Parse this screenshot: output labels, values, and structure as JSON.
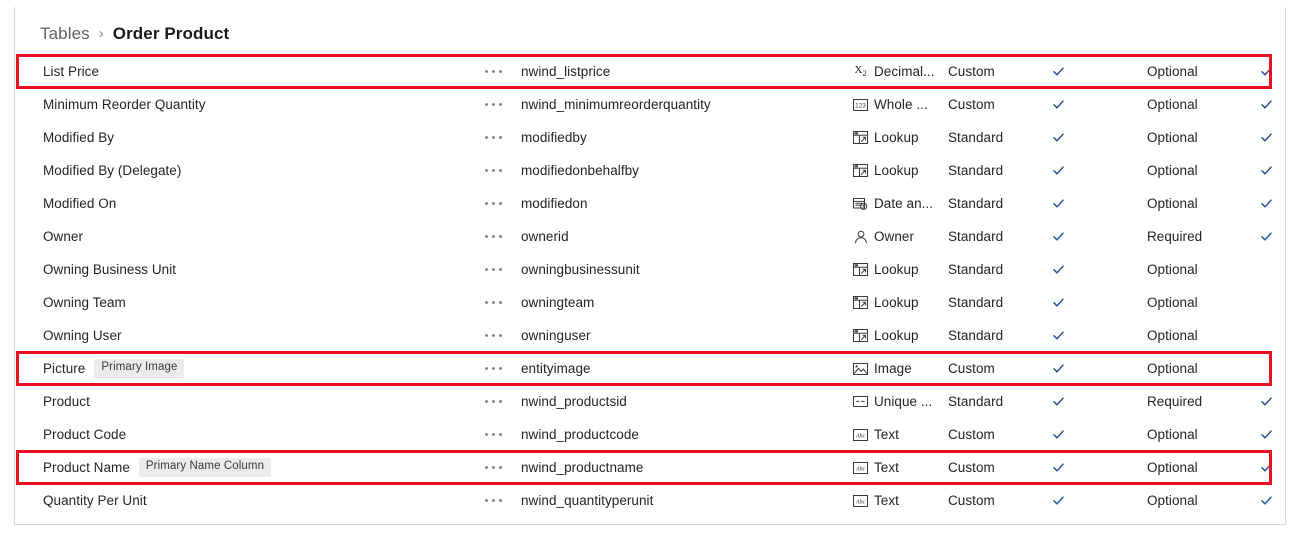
{
  "breadcrumb": {
    "parent": "Tables",
    "separator": "›",
    "current": "Order Product"
  },
  "colors": {
    "highlight": "#e81123",
    "checkmark": "#2b579a",
    "badge_bg": "#edebe9",
    "panel_border": "#d6d6d6",
    "text": "#252423",
    "breadcrumb_parent": "#616161"
  },
  "icons": {
    "ellipsis": "more-menu-icon",
    "check": "checkmark-icon",
    "decimal": "decimal-number-icon",
    "whole": "whole-number-icon",
    "lookup": "lookup-icon",
    "datetime": "date-time-icon",
    "owner": "owner-person-icon",
    "image": "image-icon",
    "unique": "unique-identifier-icon",
    "text": "text-abc-icon"
  },
  "grid": {
    "rows": [
      {
        "display_name": "List Price",
        "badge": null,
        "logical_name": "nwind_listprice",
        "data_type": "Decimal...",
        "type_icon": "decimal",
        "origin": "Custom",
        "check1": true,
        "required": "Optional",
        "check2": true,
        "highlighted": true
      },
      {
        "display_name": "Minimum Reorder Quantity",
        "badge": null,
        "logical_name": "nwind_minimumreorderquantity",
        "data_type": "Whole ...",
        "type_icon": "whole",
        "origin": "Custom",
        "check1": true,
        "required": "Optional",
        "check2": true,
        "highlighted": false
      },
      {
        "display_name": "Modified By",
        "badge": null,
        "logical_name": "modifiedby",
        "data_type": "Lookup",
        "type_icon": "lookup",
        "origin": "Standard",
        "check1": true,
        "required": "Optional",
        "check2": true,
        "highlighted": false
      },
      {
        "display_name": "Modified By (Delegate)",
        "badge": null,
        "logical_name": "modifiedonbehalfby",
        "data_type": "Lookup",
        "type_icon": "lookup",
        "origin": "Standard",
        "check1": true,
        "required": "Optional",
        "check2": true,
        "highlighted": false
      },
      {
        "display_name": "Modified On",
        "badge": null,
        "logical_name": "modifiedon",
        "data_type": "Date an...",
        "type_icon": "datetime",
        "origin": "Standard",
        "check1": true,
        "required": "Optional",
        "check2": true,
        "highlighted": false
      },
      {
        "display_name": "Owner",
        "badge": null,
        "logical_name": "ownerid",
        "data_type": "Owner",
        "type_icon": "owner",
        "origin": "Standard",
        "check1": true,
        "required": "Required",
        "check2": true,
        "highlighted": false
      },
      {
        "display_name": "Owning Business Unit",
        "badge": null,
        "logical_name": "owningbusinessunit",
        "data_type": "Lookup",
        "type_icon": "lookup",
        "origin": "Standard",
        "check1": true,
        "required": "Optional",
        "check2": false,
        "highlighted": false
      },
      {
        "display_name": "Owning Team",
        "badge": null,
        "logical_name": "owningteam",
        "data_type": "Lookup",
        "type_icon": "lookup",
        "origin": "Standard",
        "check1": true,
        "required": "Optional",
        "check2": false,
        "highlighted": false
      },
      {
        "display_name": "Owning User",
        "badge": null,
        "logical_name": "owninguser",
        "data_type": "Lookup",
        "type_icon": "lookup",
        "origin": "Standard",
        "check1": true,
        "required": "Optional",
        "check2": false,
        "highlighted": false
      },
      {
        "display_name": "Picture",
        "badge": "Primary Image",
        "logical_name": "entityimage",
        "data_type": "Image",
        "type_icon": "image",
        "origin": "Custom",
        "check1": true,
        "required": "Optional",
        "check2": false,
        "highlighted": true
      },
      {
        "display_name": "Product",
        "badge": null,
        "logical_name": "nwind_productsid",
        "data_type": "Unique ...",
        "type_icon": "unique",
        "origin": "Standard",
        "check1": true,
        "required": "Required",
        "check2": true,
        "highlighted": false
      },
      {
        "display_name": "Product Code",
        "badge": null,
        "logical_name": "nwind_productcode",
        "data_type": "Text",
        "type_icon": "text",
        "origin": "Custom",
        "check1": true,
        "required": "Optional",
        "check2": true,
        "highlighted": false
      },
      {
        "display_name": "Product Name",
        "badge": "Primary Name Column",
        "logical_name": "nwind_productname",
        "data_type": "Text",
        "type_icon": "text",
        "origin": "Custom",
        "check1": true,
        "required": "Optional",
        "check2": true,
        "highlighted": true
      },
      {
        "display_name": "Quantity Per Unit",
        "badge": null,
        "logical_name": "nwind_quantityperunit",
        "data_type": "Text",
        "type_icon": "text",
        "origin": "Custom",
        "check1": true,
        "required": "Optional",
        "check2": true,
        "highlighted": false
      }
    ]
  }
}
